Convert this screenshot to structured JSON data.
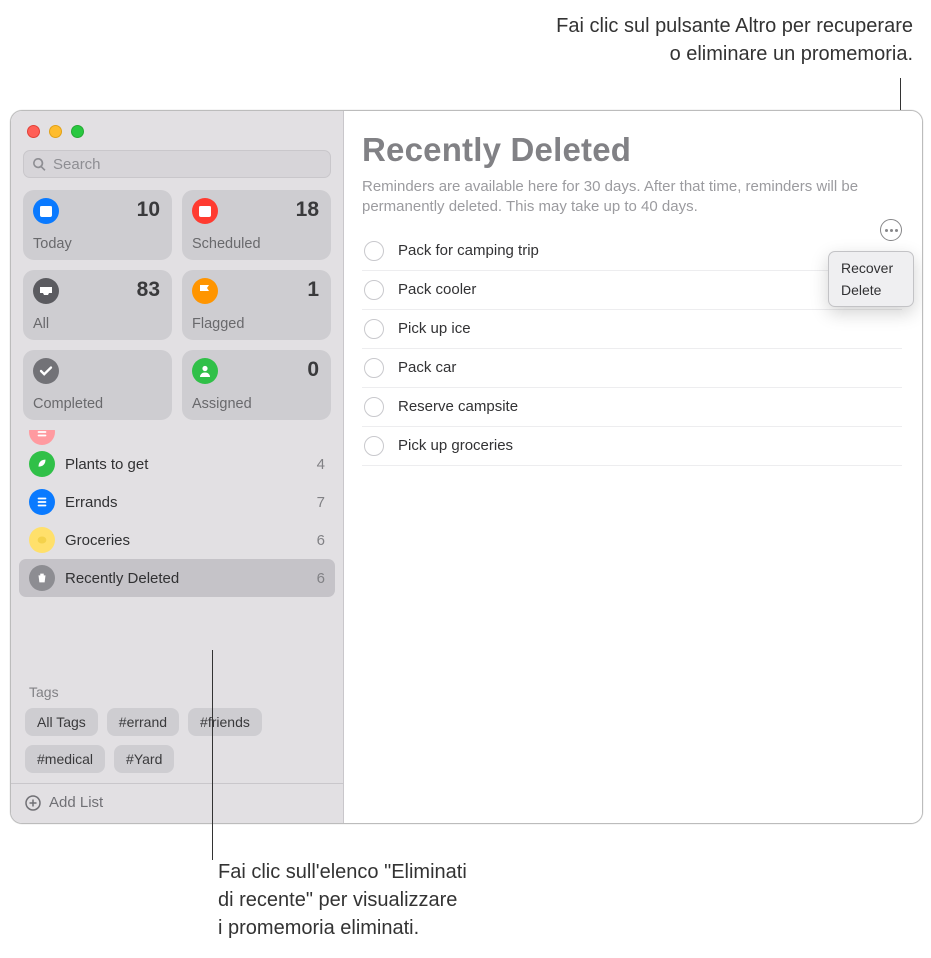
{
  "callouts": {
    "top": "Fai clic sul pulsante Altro per recuperare\no eliminare un promemoria.",
    "bottom": "Fai clic sull'elenco \"Eliminati\ndi recente\" per visualizzare\ni promemoria eliminati."
  },
  "search": {
    "placeholder": "Search"
  },
  "smart": [
    {
      "name": "Today",
      "count": "10",
      "color": "#0a7aff",
      "icon": "calendar"
    },
    {
      "name": "Scheduled",
      "count": "18",
      "color": "#ff3b30",
      "icon": "calendar"
    },
    {
      "name": "All",
      "count": "83",
      "color": "#5b5b60",
      "icon": "tray"
    },
    {
      "name": "Flagged",
      "count": "1",
      "color": "#ff9500",
      "icon": "flag"
    },
    {
      "name": "Completed",
      "count": "",
      "color": "#727277",
      "icon": "check"
    },
    {
      "name": "Assigned",
      "count": "0",
      "color": "#30c048",
      "icon": "person"
    }
  ],
  "lists": [
    {
      "name": "",
      "count": "",
      "color": "#ff9aa0",
      "icon": "list",
      "trunc": true
    },
    {
      "name": "Plants to get",
      "count": "4",
      "color": "#30c048",
      "icon": "leaf"
    },
    {
      "name": "Errands",
      "count": "7",
      "color": "#0a7aff",
      "icon": "list"
    },
    {
      "name": "Groceries",
      "count": "6",
      "color": "#ffe06b",
      "icon": "lemon"
    },
    {
      "name": "Recently Deleted",
      "count": "6",
      "color": "#8d8d92",
      "icon": "trash",
      "selected": true
    }
  ],
  "tagsHeader": "Tags",
  "tags": [
    "All Tags",
    "#errand",
    "#friends",
    "#medical",
    "#Yard"
  ],
  "addList": "Add List",
  "main": {
    "title": "Recently Deleted",
    "desc": "Reminders are available here for 30 days. After that time, reminders will be permanently deleted. This may take up to 40 days.",
    "items": [
      "Pack for camping trip",
      "Pack cooler",
      "Pick up ice",
      "Pack car",
      "Reserve campsite",
      "Pick up groceries"
    ]
  },
  "popover": {
    "recover": "Recover",
    "delete": "Delete"
  }
}
